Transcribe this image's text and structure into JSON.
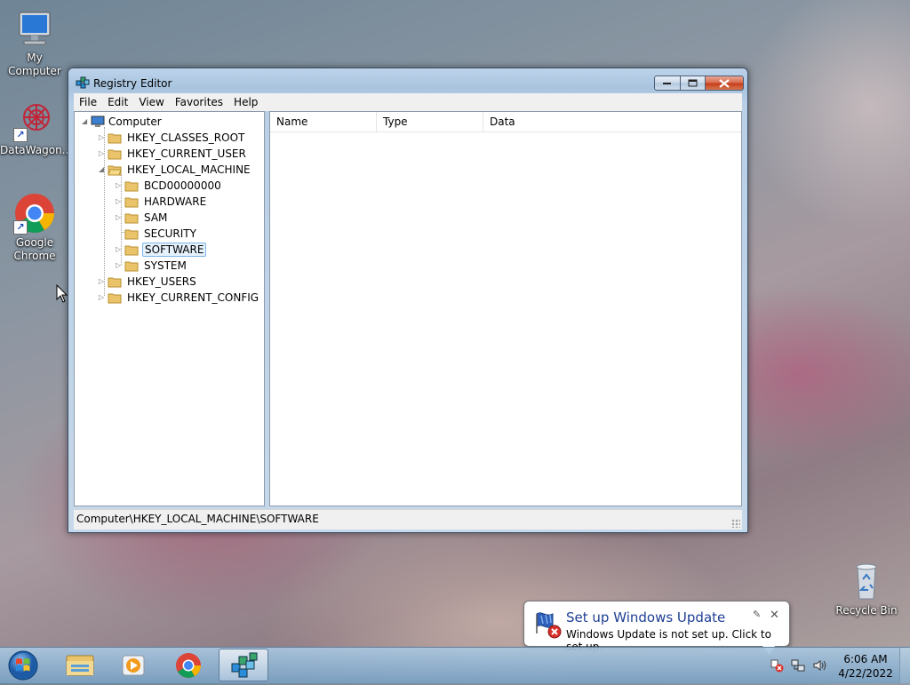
{
  "desktop": {
    "icons": [
      {
        "label": "My Computer"
      },
      {
        "label": "DataWagon..."
      },
      {
        "label": "Google Chrome"
      },
      {
        "label": "Recycle Bin"
      }
    ]
  },
  "window": {
    "title": "Registry Editor",
    "menu": [
      "File",
      "Edit",
      "View",
      "Favorites",
      "Help"
    ],
    "tree": {
      "root": "Computer",
      "hives": [
        {
          "label": "HKEY_CLASSES_ROOT"
        },
        {
          "label": "HKEY_CURRENT_USER"
        },
        {
          "label": "HKEY_LOCAL_MACHINE",
          "expanded": true,
          "children": [
            "BCD00000000",
            "HARDWARE",
            "SAM",
            "SECURITY",
            "SOFTWARE",
            "SYSTEM"
          ],
          "selected_child": "SOFTWARE"
        },
        {
          "label": "HKEY_USERS"
        },
        {
          "label": "HKEY_CURRENT_CONFIG"
        }
      ]
    },
    "columns": [
      "Name",
      "Type",
      "Data"
    ],
    "status_path": "Computer\\HKEY_LOCAL_MACHINE\\SOFTWARE"
  },
  "notification": {
    "title": "Set up Windows Update",
    "message": "Windows Update is not set up. Click to set up."
  },
  "taskbar": {
    "time": "6:06 AM",
    "date": "4/22/2022"
  },
  "colors": {
    "balloon_title": "#1e3f94",
    "selection": "#e5f1fb"
  }
}
